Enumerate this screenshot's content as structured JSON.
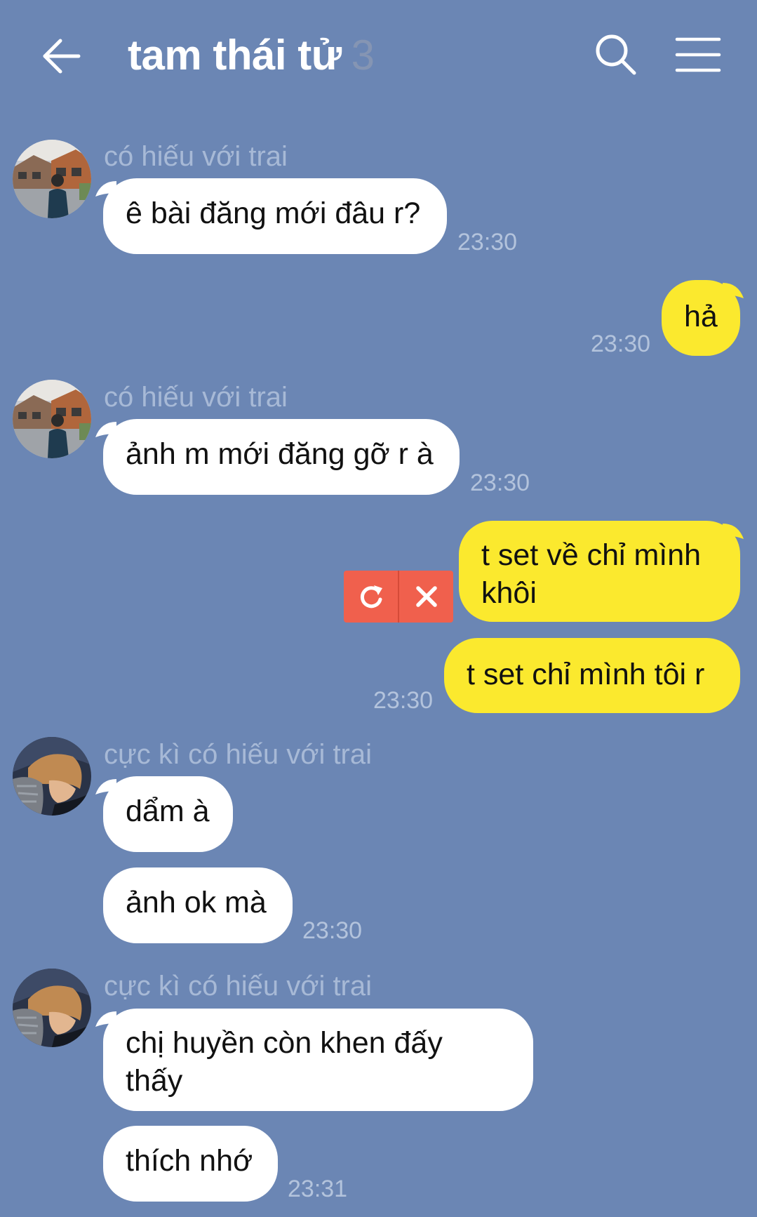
{
  "header": {
    "title": "tam thái tử",
    "member_count": "3",
    "back_icon": "arrow-left-icon",
    "search_icon": "search-icon",
    "menu_icon": "menu-icon"
  },
  "messages": [
    {
      "direction": "in",
      "sender": "có hiếu với trai",
      "text": "ê bài đăng mới đâu r?",
      "time": "23:30"
    },
    {
      "direction": "out",
      "text": "hả",
      "time": "23:30"
    },
    {
      "direction": "in",
      "sender": "có hiếu với trai",
      "text": "ảnh m mới đăng gỡ r à",
      "time": "23:30"
    },
    {
      "direction": "out",
      "text_line1": "t set về chỉ mình",
      "text_line2": "khôi",
      "status": "failed",
      "retry_icon": "retry-icon",
      "delete_icon": "close-icon"
    },
    {
      "direction": "out",
      "text": "t set chỉ mình tôi r",
      "time": "23:30"
    },
    {
      "direction": "in",
      "sender": "cực kì có hiếu với trai",
      "text": "dẩm à"
    },
    {
      "direction": "in",
      "text": "ảnh ok mà",
      "time": "23:30"
    },
    {
      "direction": "in",
      "sender": "cực kì có hiếu với trai",
      "text_line1": "chị huyền còn khen đấy",
      "text_line2": "thấy"
    },
    {
      "direction": "in",
      "text": "thích nhớ",
      "time": "23:31"
    }
  ],
  "colors": {
    "background": "#6b86b4",
    "incoming_bubble": "#ffffff",
    "outgoing_bubble": "#fbe92e",
    "failed_badge": "#f0604d"
  }
}
